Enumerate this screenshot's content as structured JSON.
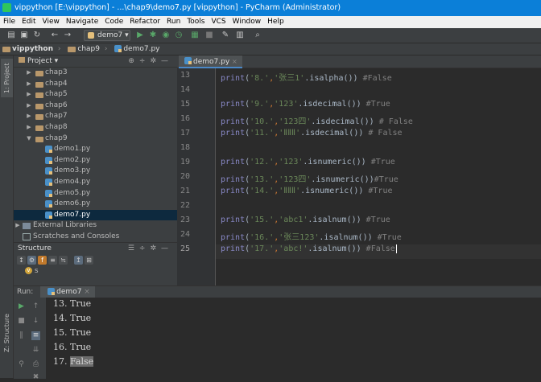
{
  "window": {
    "title": "vippython [E:\\vippython] - ...\\chap9\\demo7.py [vippython] - PyCharm (Administrator)"
  },
  "menu": [
    "File",
    "Edit",
    "View",
    "Navigate",
    "Code",
    "Refactor",
    "Run",
    "Tools",
    "VCS",
    "Window",
    "Help"
  ],
  "toolbar": {
    "run_config": "demo7"
  },
  "breadcrumb": {
    "project": "vippython",
    "folder": "chap9",
    "file": "demo7.py"
  },
  "side_tabs": {
    "project": "1: Project",
    "structure": "Z: Structure"
  },
  "project_panel": {
    "header": "Project",
    "tree": [
      {
        "label": "chap3",
        "type": "folder",
        "expanded": false
      },
      {
        "label": "chap4",
        "type": "folder",
        "expanded": false
      },
      {
        "label": "chap5",
        "type": "folder",
        "expanded": false
      },
      {
        "label": "chap6",
        "type": "folder",
        "expanded": false
      },
      {
        "label": "chap7",
        "type": "folder",
        "expanded": false
      },
      {
        "label": "chap8",
        "type": "folder",
        "expanded": false
      },
      {
        "label": "chap9",
        "type": "folder",
        "expanded": true
      },
      {
        "label": "demo1.py",
        "type": "file"
      },
      {
        "label": "demo2.py",
        "type": "file"
      },
      {
        "label": "demo3.py",
        "type": "file"
      },
      {
        "label": "demo4.py",
        "type": "file"
      },
      {
        "label": "demo5.py",
        "type": "file"
      },
      {
        "label": "demo6.py",
        "type": "file"
      },
      {
        "label": "demo7.py",
        "type": "file",
        "selected": true
      },
      {
        "label": "External Libraries",
        "type": "lib"
      },
      {
        "label": "Scratches and Consoles",
        "type": "scratch"
      }
    ]
  },
  "structure_panel": {
    "header": "Structure",
    "item": "s"
  },
  "editor": {
    "tab": "demo7.py",
    "lines": [
      {
        "n": "13",
        "fn": "print",
        "open": "(",
        "arg1": "'8.'",
        "comma": ",",
        "arg2": "'张三1'",
        "method": ".isalpha()",
        "close": ")",
        "comment": " #False"
      },
      {
        "n": "14"
      },
      {
        "n": "15",
        "fn": "print",
        "open": "(",
        "arg1": "'9.'",
        "comma": ",",
        "arg2": "'123'",
        "method": ".isdecimal()",
        "close": ")",
        "comment": " #True"
      },
      {
        "n": "16",
        "fn": "print",
        "open": "(",
        "arg1": "'10.'",
        "comma": ",",
        "arg2": "'123四'",
        "method": ".isdecimal()",
        "close": ")",
        "comment": " # False"
      },
      {
        "n": "17",
        "fn": "print",
        "open": "(",
        "arg1": "'11.'",
        "comma": ",",
        "arg2": "'ⅡⅡⅡ'",
        "method": ".isdecimal()",
        "close": ")",
        "comment": " # False"
      },
      {
        "n": "18"
      },
      {
        "n": "19",
        "fn": "print",
        "open": "(",
        "arg1": "'12.'",
        "comma": ",",
        "arg2": "'123'",
        "method": ".isnumeric()",
        "close": ")",
        "comment": " #True"
      },
      {
        "n": "20",
        "fn": "print",
        "open": "(",
        "arg1": "'13.'",
        "comma": ",",
        "arg2": "'123四'",
        "method": ".isnumeric()",
        "close": ")",
        "comment": "#True"
      },
      {
        "n": "21",
        "fn": "print",
        "open": "(",
        "arg1": "'14.'",
        "comma": ",",
        "arg2": "'ⅡⅡⅡ'",
        "method": ".isnumeric()",
        "close": ")",
        "comment": " #True"
      },
      {
        "n": "22"
      },
      {
        "n": "23",
        "fn": "print",
        "open": "(",
        "arg1": "'15.'",
        "comma": ",",
        "arg2": "'abc1'",
        "method": ".isalnum()",
        "close": ")",
        "comment": " #True"
      },
      {
        "n": "24",
        "fn": "print",
        "open": "(",
        "arg1": "'16.'",
        "comma": ",",
        "arg2": "'张三123'",
        "method": ".isalnum()",
        "close": ")",
        "comment": " #True"
      },
      {
        "n": "25",
        "fn": "print",
        "open": "(",
        "arg1": "'17.'",
        "comma": ",",
        "arg2": "'abc!'",
        "method": ".isalnum()",
        "close": ")",
        "comment": " #False",
        "current": true
      }
    ]
  },
  "run_panel": {
    "label": "Run:",
    "tab": "demo7",
    "output": [
      {
        "num": "13.",
        "value": "True"
      },
      {
        "num": "14.",
        "value": "True"
      },
      {
        "num": "15.",
        "value": "True"
      },
      {
        "num": "16.",
        "value": "True"
      },
      {
        "num": "17.",
        "value": "False",
        "selected": true
      }
    ]
  }
}
